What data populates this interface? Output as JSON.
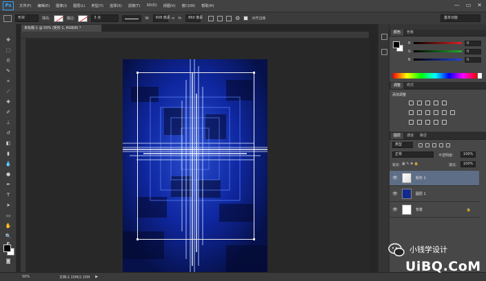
{
  "app": {
    "logo": "Ps"
  },
  "menubar": {
    "items": [
      "文件(F)",
      "编辑(E)",
      "图像(I)",
      "图层(L)",
      "类型(Y)",
      "选择(S)",
      "滤镜(T)",
      "3D(D)",
      "视图(V)",
      "窗口(W)",
      "帮助(H)"
    ],
    "window_controls": [
      "—",
      "▭",
      "✕"
    ]
  },
  "options": {
    "mode": "形状",
    "fill_label": "填充:",
    "stroke_label": "描边:",
    "stroke_size": "3 点",
    "w_label": "W:",
    "w_value": "608 像素",
    "h_label": "H:",
    "h_value": "860 像素",
    "align_edges_label": "对齐边缘",
    "workspace": "基本功能"
  },
  "document": {
    "tab_title": "未标题-1 @ 50% (矩形 1, RGB/8) *"
  },
  "statusbar": {
    "zoom": "50%",
    "doc_size": "文档:2.15M/2.15M"
  },
  "color_panel": {
    "tabs": [
      "颜色",
      "色板"
    ],
    "channels": [
      {
        "label": "R",
        "value": "0",
        "bar": "#e02020"
      },
      {
        "label": "G",
        "value": "0",
        "bar": "#20b030"
      },
      {
        "label": "B",
        "value": "0",
        "bar": "#2040e0"
      }
    ]
  },
  "adjust_panel": {
    "tabs": [
      "调整",
      "样式"
    ],
    "title": "添加调整"
  },
  "layers_panel": {
    "tabs": [
      "图层",
      "通道",
      "路径"
    ],
    "filter_kind": "类型",
    "blend_mode": "正常",
    "opacity_label": "不透明度:",
    "opacity_value": "100%",
    "lock_label": "锁定:",
    "fill_label": "填充:",
    "fill_value": "100%",
    "layers": [
      {
        "name": "矩形 1",
        "selected": true
      },
      {
        "name": "图层 1",
        "selected": false
      },
      {
        "name": "背景",
        "selected": false
      }
    ]
  },
  "watermark": {
    "text": "小钱学设计",
    "site": "UiBQ.CoM"
  }
}
